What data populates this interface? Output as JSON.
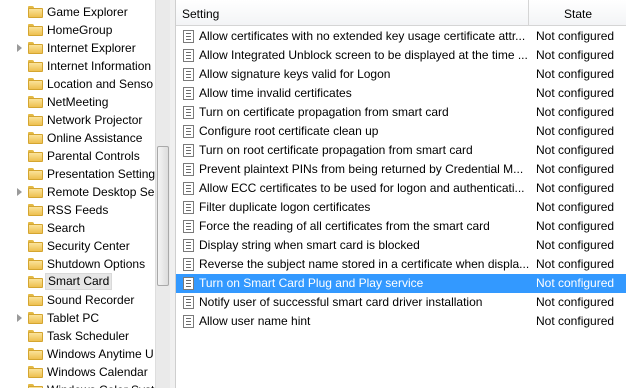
{
  "tree": {
    "items": [
      {
        "label": "Game Explorer",
        "expandable": false
      },
      {
        "label": "HomeGroup",
        "expandable": false
      },
      {
        "label": "Internet Explorer",
        "expandable": true
      },
      {
        "label": "Internet Information",
        "expandable": false
      },
      {
        "label": "Location and Senso",
        "expandable": false
      },
      {
        "label": "NetMeeting",
        "expandable": false
      },
      {
        "label": "Network Projector",
        "expandable": false
      },
      {
        "label": "Online Assistance",
        "expandable": false
      },
      {
        "label": "Parental Controls",
        "expandable": false
      },
      {
        "label": "Presentation Setting",
        "expandable": false
      },
      {
        "label": "Remote Desktop Ser",
        "expandable": true
      },
      {
        "label": "RSS Feeds",
        "expandable": false
      },
      {
        "label": "Search",
        "expandable": false
      },
      {
        "label": "Security Center",
        "expandable": false
      },
      {
        "label": "Shutdown Options",
        "expandable": false
      },
      {
        "label": "Smart Card",
        "expandable": false,
        "selected": true
      },
      {
        "label": "Sound Recorder",
        "expandable": false
      },
      {
        "label": "Tablet PC",
        "expandable": true
      },
      {
        "label": "Task Scheduler",
        "expandable": false
      },
      {
        "label": "Windows Anytime U",
        "expandable": false
      },
      {
        "label": "Windows Calendar",
        "expandable": false
      },
      {
        "label": "Windows Color Syst",
        "expandable": false
      }
    ]
  },
  "list": {
    "header": {
      "setting": "Setting",
      "state": "State"
    },
    "rows": [
      {
        "name": "Allow certificates with no extended key usage certificate attr...",
        "state": "Not configured"
      },
      {
        "name": "Allow Integrated Unblock screen to be displayed at the time ...",
        "state": "Not configured"
      },
      {
        "name": "Allow signature keys valid for Logon",
        "state": "Not configured"
      },
      {
        "name": "Allow time invalid certificates",
        "state": "Not configured"
      },
      {
        "name": "Turn on certificate propagation from smart card",
        "state": "Not configured"
      },
      {
        "name": "Configure root certificate clean up",
        "state": "Not configured"
      },
      {
        "name": "Turn on root certificate propagation from smart card",
        "state": "Not configured"
      },
      {
        "name": "Prevent plaintext PINs from being returned by Credential M...",
        "state": "Not configured"
      },
      {
        "name": "Allow ECC certificates to be used for logon and authenticati...",
        "state": "Not configured"
      },
      {
        "name": "Filter duplicate logon certificates",
        "state": "Not configured"
      },
      {
        "name": "Force the reading of all certificates from the smart card",
        "state": "Not configured"
      },
      {
        "name": "Display string when smart card is blocked",
        "state": "Not configured"
      },
      {
        "name": "Reverse the subject name stored in a certificate when displa...",
        "state": "Not configured"
      },
      {
        "name": "Turn on Smart Card Plug and Play service",
        "state": "Not configured",
        "selected": true
      },
      {
        "name": "Notify user of successful smart card driver installation",
        "state": "Not configured"
      },
      {
        "name": "Allow user name hint",
        "state": "Not configured"
      }
    ]
  },
  "colors": {
    "selection": "#3399ff",
    "folder": "#edc04f"
  },
  "icons": {
    "tree": "folder-icon",
    "expander": "expand-arrow-icon",
    "policy": "policy-setting-icon"
  }
}
